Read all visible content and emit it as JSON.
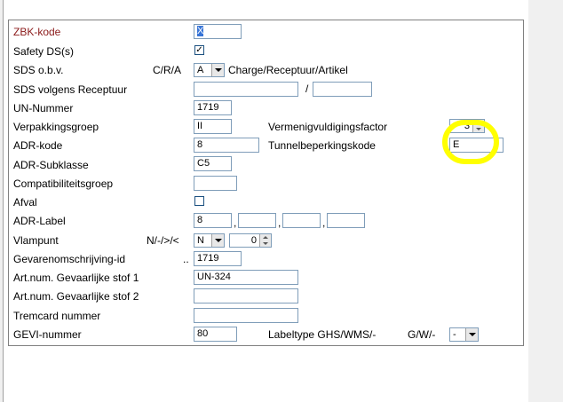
{
  "fields": {
    "zbk_kode": {
      "label": "ZBK-kode",
      "value": "X"
    },
    "safety_ds": {
      "label": "Safety DS(s)",
      "checked": true
    },
    "sds_obv": {
      "label": "SDS o.b.v.",
      "code_label": "C/R/A",
      "selected": "A",
      "description": "Charge/Receptuur/Artikel"
    },
    "sds_volgens_receptuur": {
      "label": "SDS volgens Receptuur",
      "value1": "",
      "separator": "/",
      "value2": ""
    },
    "un_nummer": {
      "label": "UN-Nummer",
      "value": "1719"
    },
    "verpakkingsgroep": {
      "label": "Verpakkingsgroep",
      "value": "II"
    },
    "vermenigvuldigingsfactor": {
      "label": "Vermenigvuldigingsfactor",
      "value": "3"
    },
    "adr_kode": {
      "label": "ADR-kode",
      "value": "8"
    },
    "tunnelbeperkingskode": {
      "label": "Tunnelbeperkingskode",
      "value": "E"
    },
    "adr_subklasse": {
      "label": "ADR-Subklasse",
      "value": "C5"
    },
    "compatibiliteitsgroep": {
      "label": "Compatibiliteitsgroep",
      "value": ""
    },
    "afval": {
      "label": "Afval",
      "checked": false
    },
    "adr_label": {
      "label": "ADR-Label",
      "values": [
        "8",
        "",
        "",
        ""
      ],
      "separator": ","
    },
    "vlampunt": {
      "label": "Vlampunt",
      "code_label": "N/-/>/<",
      "selected": "N",
      "value": "0"
    },
    "gevarenomschrijving_id": {
      "label": "Gevarenomschrijving-id",
      "prefix": "..",
      "value": "1719"
    },
    "art_num_1": {
      "label": "Art.num. Gevaarlijke stof 1",
      "value": "UN-324"
    },
    "art_num_2": {
      "label": "Art.num. Gevaarlijke stof 2",
      "value": ""
    },
    "tremcard": {
      "label": "Tremcard nummer",
      "value": ""
    },
    "gevi_nummer": {
      "label": "GEVI-nummer",
      "value": "80"
    },
    "labeltype": {
      "label": "Labeltype GHS/WMS/-",
      "code_label": "G/W/-",
      "selected": "-"
    }
  },
  "colors": {
    "highlight": "#ffff00",
    "required_label": "#8b1a1a"
  }
}
